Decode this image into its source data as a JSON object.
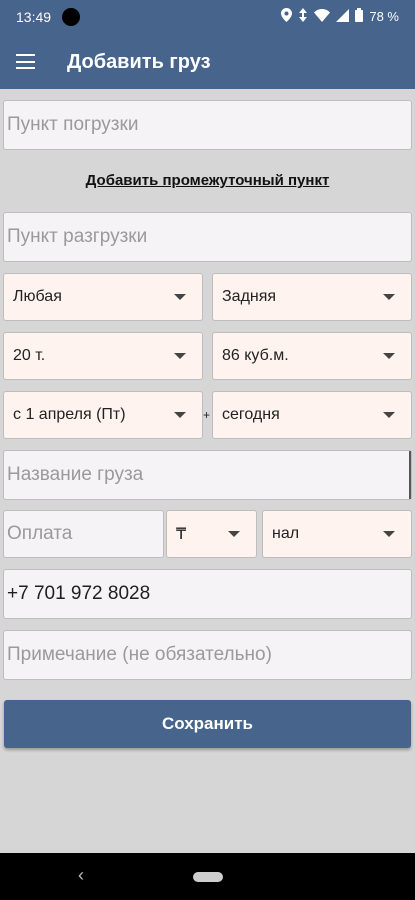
{
  "status_bar": {
    "time": "13:49",
    "battery": "78 %"
  },
  "app_bar": {
    "title": "Добавить груз"
  },
  "form": {
    "loading_point_placeholder": "Пункт погрузки",
    "add_intermediate_link": "Добавить промежуточный пункт",
    "unloading_point_placeholder": "Пункт разгрузки",
    "body_type": "Любая",
    "loading_type": "Задняя",
    "weight": "20 т.",
    "volume": "86 куб.м.",
    "date_from": "с 1 апреля (Пт)",
    "plus_sign": "+",
    "date_to": "сегодня",
    "cargo_name_placeholder": "Название груза",
    "payment_placeholder": "Оплата",
    "currency": "₸",
    "payment_type": "нал",
    "phone": "+7 701 972 8028",
    "note_placeholder": "Примечание (не обязательно)",
    "save_label": "Сохранить"
  },
  "nav_bar": {
    "back_icon": "‹"
  },
  "colors": {
    "primary": "#46648c",
    "background": "#d6d6d6",
    "dropdown_bg": "#fff3ef",
    "input_bg": "#f5f3f6"
  }
}
